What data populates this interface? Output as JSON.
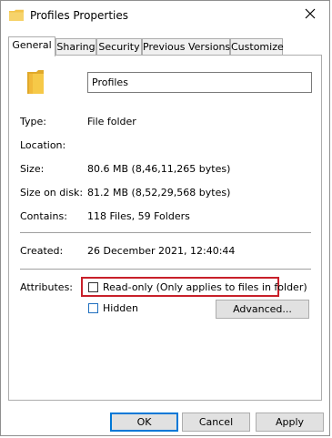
{
  "window": {
    "title": "Profiles Properties"
  },
  "tabs": [
    {
      "label": "General",
      "active": true
    },
    {
      "label": "Sharing"
    },
    {
      "label": "Security"
    },
    {
      "label": "Previous Versions"
    },
    {
      "label": "Customize"
    }
  ],
  "general": {
    "name_value": "Profiles",
    "type": {
      "label": "Type:",
      "value": "File folder"
    },
    "location": {
      "label": "Location:",
      "value": ""
    },
    "size": {
      "label": "Size:",
      "value": "80.6 MB (8,46,11,265 bytes)"
    },
    "size_on_disk": {
      "label": "Size on disk:",
      "value": "81.2 MB (8,52,29,568 bytes)"
    },
    "contains": {
      "label": "Contains:",
      "value": "118 Files, 59 Folders"
    },
    "created": {
      "label": "Created:",
      "value": "26 December 2021, 12:40:44"
    },
    "attributes": {
      "label": "Attributes:",
      "readonly_label": "Read-only (Only applies to files in folder)",
      "readonly_checked": false,
      "hidden_label": "Hidden",
      "hidden_checked": false,
      "advanced_label": "Advanced..."
    }
  },
  "buttons": {
    "ok": "OK",
    "cancel": "Cancel",
    "apply": "Apply"
  },
  "colors": {
    "highlight_box": "#c8202a",
    "folder": "#f3c44b",
    "default_button_border": "#0078d7"
  },
  "icons": {
    "title": "folder-icon",
    "close": "close-icon",
    "folder_large": "folder-icon"
  }
}
